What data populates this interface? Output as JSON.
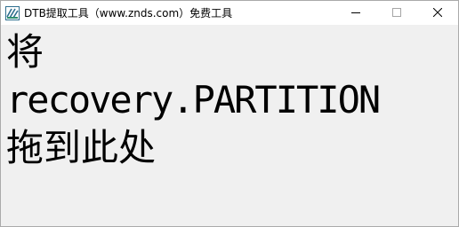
{
  "window": {
    "title": "DTB提取工具（www.znds.com）免费工具",
    "icon": "app-logo-icon",
    "caption": {
      "minimize_icon": "minimize-icon",
      "maximize_icon": "maximize-icon",
      "close_icon": "close-icon"
    }
  },
  "drop_area": {
    "line1": "将",
    "line2": "recovery.PARTITION",
    "line3": "拖到此处"
  }
}
